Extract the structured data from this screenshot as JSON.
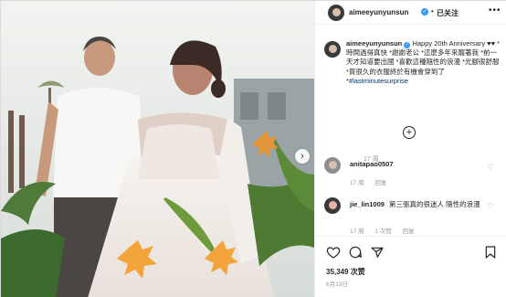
{
  "header": {
    "username": "aimeeyunyunsun",
    "verified_icon": "verified-badge-icon",
    "separator": "•",
    "follow_status": "已关注",
    "more_icon": "more-options-icon"
  },
  "caption": {
    "username": "aimeeyunyunsun",
    "line1": "Happy 20th Anniversary ♥♥ *時間過得真快 *謝謝老公",
    "line2": "*這麼多年來寵著我",
    "line3": "*前一天才知道要出國 *喜歡這種隨性的浪漫 *光腳很舒服 *買很久的衣服終於有機會穿到了",
    "hashtag": "*#lastminutesurprise",
    "time": "17 周"
  },
  "load_more": "+",
  "comments": [
    {
      "username": "anitapao0507",
      "text": "",
      "time": "17 周",
      "reply_label": "回复",
      "likes": ""
    },
    {
      "username": "jie_lin1009",
      "text": "第三張真的很迷人 隨性的浪漫",
      "time": "17 周",
      "likes": "1 次赞",
      "reply_label": "回复"
    }
  ],
  "photo": {
    "next_icon": "chevron-right-icon",
    "next_glyph": "›"
  },
  "actions": {
    "like_icon": "heart-icon",
    "comment_icon": "comment-icon",
    "share_icon": "share-icon",
    "save_icon": "bookmark-icon"
  },
  "likes_text": "35,349 次赞",
  "post_date": "6月23日",
  "colors": {
    "text": "#262626",
    "muted": "#999999",
    "link": "#003569",
    "verified": "#3897f0",
    "border": "#efefef"
  }
}
